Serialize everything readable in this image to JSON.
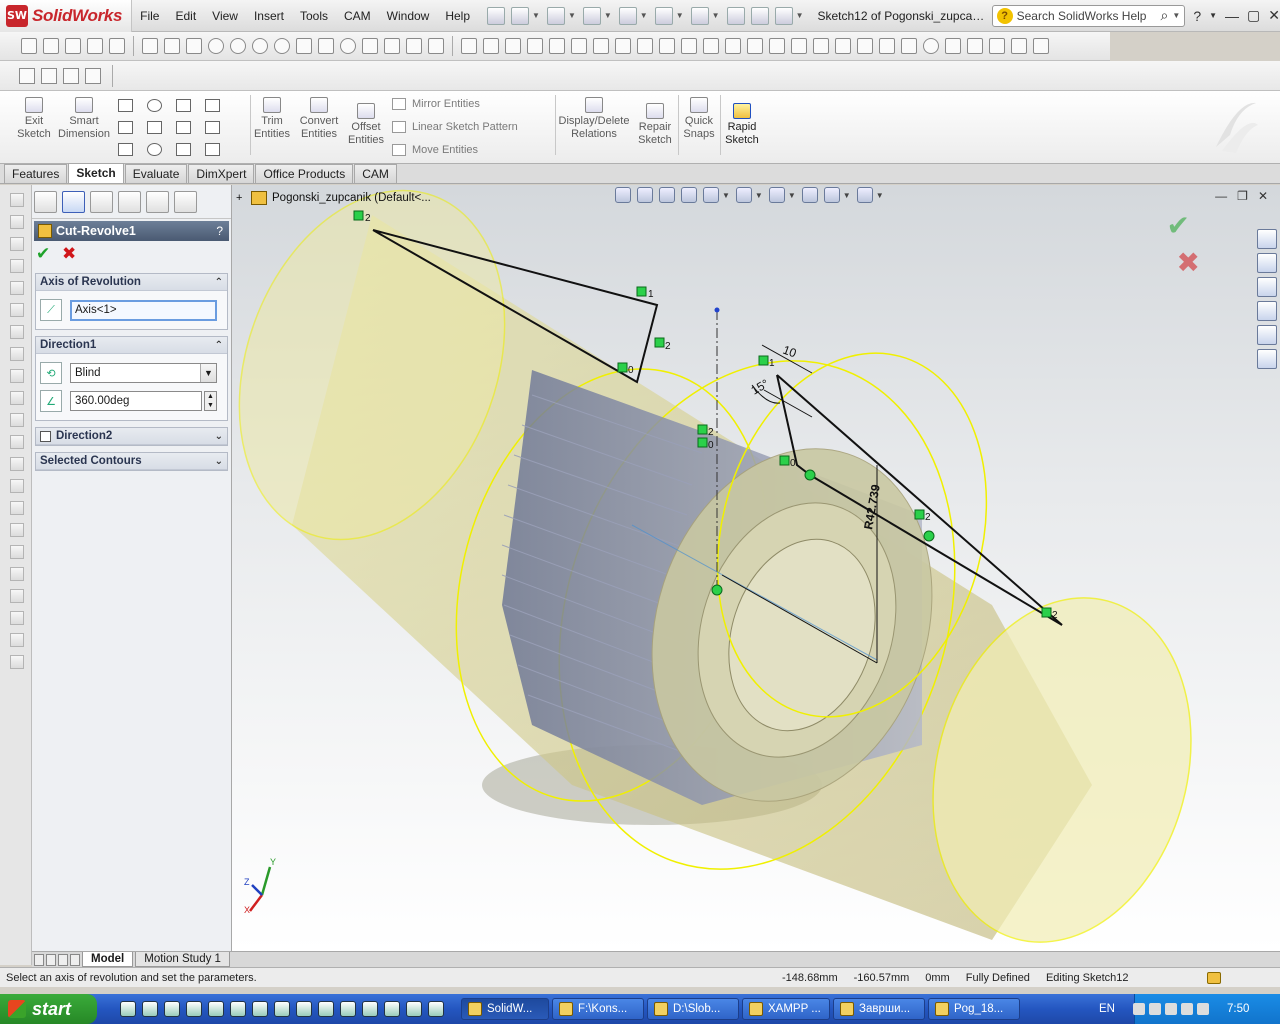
{
  "app": {
    "brand": "SolidWorks",
    "badge": "SW",
    "doc_title": "Sketch12 of Pogonski_zupcanik....",
    "menus": [
      "File",
      "Edit",
      "View",
      "Insert",
      "Tools",
      "CAM",
      "Window",
      "Help"
    ],
    "search": {
      "placeholder": "Search SolidWorks Help"
    }
  },
  "command_manager": {
    "exit_sketch": "Exit\nSketch",
    "smart_dimension": "Smart\nDimension",
    "trim_entities": "Trim\nEntities",
    "convert_entities": "Convert\nEntities",
    "offset_entities": "Offset\nEntities",
    "mirror_entities": "Mirror Entities",
    "linear_sketch_pattern": "Linear Sketch Pattern",
    "move_entities": "Move Entities",
    "display_delete_relations": "Display/Delete\nRelations",
    "repair_sketch": "Repair\nSketch",
    "quick_snaps": "Quick\nSnaps",
    "rapid_sketch": "Rapid\nSketch"
  },
  "tabs": [
    "Features",
    "Sketch",
    "Evaluate",
    "DimXpert",
    "Office Products",
    "CAM"
  ],
  "active_tab": "Sketch",
  "property_manager": {
    "title": "Cut-Revolve1",
    "axis_group": {
      "title": "Axis of Revolution",
      "axis_value": "Axis<1>"
    },
    "direction1": {
      "title": "Direction1",
      "type": "Blind",
      "angle": "360.00deg"
    },
    "direction2": {
      "title": "Direction2"
    },
    "selected_contours": {
      "title": "Selected Contours"
    }
  },
  "viewport": {
    "tree_item": "Pogonski_zupcanik  (Default<...",
    "dimensions": {
      "length": "10",
      "angle": "15°",
      "radius": "R42.739"
    },
    "relation_tags": [
      "2",
      "1",
      "2",
      "0",
      "1",
      "2",
      "0",
      "0",
      "2",
      "2"
    ],
    "triad": {
      "x": "X",
      "y": "Y",
      "z": "Z"
    }
  },
  "model_tabs": [
    "Model",
    "Motion Study 1"
  ],
  "status": {
    "message": "Select an axis of revolution and set the parameters.",
    "x": "-148.68mm",
    "y": "-160.57mm",
    "z": "0mm",
    "state": "Fully Defined",
    "editing": "Editing Sketch12"
  },
  "taskbar": {
    "start": "start",
    "tasks": [
      "SolidW...",
      "F:\\Kons...",
      "D:\\Slob...",
      "XAMPP ...",
      "Заврши...",
      "Pog_18..."
    ],
    "active_task": "SolidW...",
    "language": "EN",
    "clock": "7:50"
  },
  "colors": {
    "accent_yellow": "#f0f000",
    "sketch_green": "#2bd04a",
    "pm_header": "#4a5a72",
    "taskbar": "#2456c0"
  }
}
